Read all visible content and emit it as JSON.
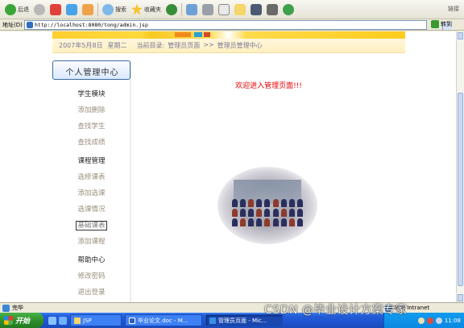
{
  "toolbar": {
    "back_label": "后退",
    "search_label": "搜索",
    "favorites_label": "收藏夹",
    "right_label": "链接"
  },
  "address": {
    "label": "地址(D)",
    "url": "http://localhost:8080/tong/admin.jsp",
    "go_label": "转到"
  },
  "datebar": {
    "date": "2007年5月8日",
    "weekday": "星期二",
    "crumb_prefix": "当前目录:",
    "crumb_1": "管理员页面",
    "crumb_sep": ">>",
    "crumb_2": "管理员管理中心"
  },
  "sidebar": {
    "title": "个人管理中心",
    "groups": [
      {
        "title": "学生模块",
        "items": [
          "添加删除",
          "查找学生",
          "查找成绩"
        ]
      },
      {
        "title": "课程管理",
        "items": [
          "选修课表",
          "添加选课",
          "选课情况",
          "基础课表",
          "添加课程"
        ]
      },
      {
        "title": "帮助中心",
        "items": [
          "修改密码",
          "退出登录"
        ]
      }
    ]
  },
  "main": {
    "welcome": "欢迎进入管理页面!!!"
  },
  "status": {
    "text": "完毕",
    "zone": "本地 Intranet"
  },
  "taskbar": {
    "start": "开始",
    "tasks": [
      "JSP",
      "毕业论文.doc - M...",
      "管理员页面 - Mic..."
    ],
    "clock": "11:08"
  },
  "watermark": "CSDN @毕业设计方案专家",
  "colors": {
    "accent_red": "#e60000",
    "banner_yellow": "#ffcf2e",
    "taskbar_blue": "#245edb"
  }
}
